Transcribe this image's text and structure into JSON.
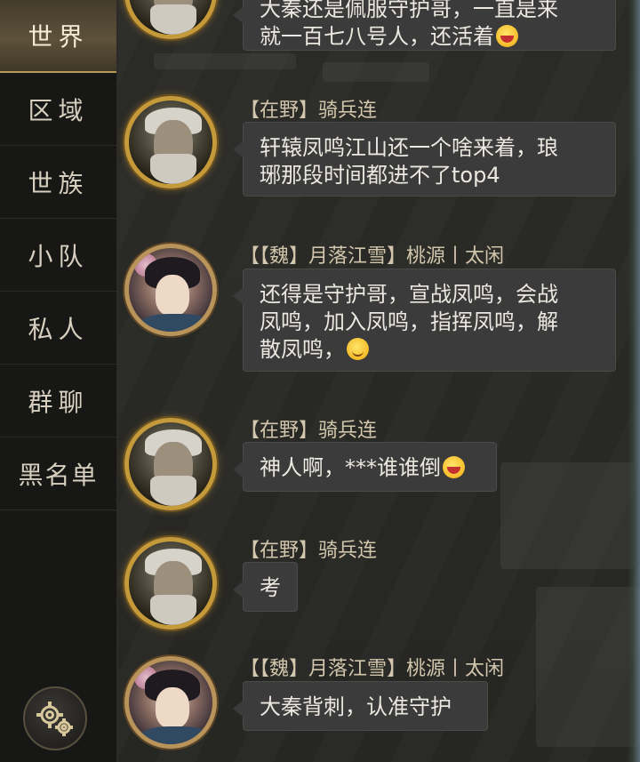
{
  "channels": [
    {
      "label": "世界",
      "active": true
    },
    {
      "label": "区域",
      "active": false
    },
    {
      "label": "世族",
      "active": false
    },
    {
      "label": "小队",
      "active": false
    },
    {
      "label": "私人",
      "active": false
    },
    {
      "label": "群聊",
      "active": false
    },
    {
      "label": "黑名单",
      "active": false
    }
  ],
  "settings_icon": "gear-icon",
  "messages": [
    {
      "avatar": "old-general-avatar",
      "sender": "",
      "lines": [
        "大秦还是佩服守护哥，一直是来",
        "就一百七八号人，还活着"
      ],
      "emoji": "grinning-emoji"
    },
    {
      "avatar": "old-general-avatar",
      "sender": "【在野】骑兵连",
      "lines": [
        "轩辕凤鸣江山还一个啥来着，琅",
        "琊那段时间都进不了top4"
      ],
      "emoji": ""
    },
    {
      "avatar": "lady-avatar",
      "sender": "【【魏】月落江雪】桃源丨太闲",
      "lines": [
        "还得是守护哥，宣战凤鸣，会战",
        "凤鸣，加入凤鸣，指挥凤鸣，解",
        "散凤鸣，"
      ],
      "emoji": "smiling-emoji"
    },
    {
      "avatar": "old-general-avatar",
      "sender": "【在野】骑兵连",
      "lines": [
        "神人啊，***谁谁倒"
      ],
      "emoji": "grinning-emoji"
    },
    {
      "avatar": "old-general-avatar",
      "sender": "【在野】骑兵连",
      "lines": [
        "考"
      ],
      "emoji": ""
    },
    {
      "avatar": "lady-avatar",
      "sender": "【【魏】月落江雪】桃源丨太闲",
      "lines": [
        "大秦背刺，认准守护"
      ],
      "emoji": ""
    }
  ]
}
